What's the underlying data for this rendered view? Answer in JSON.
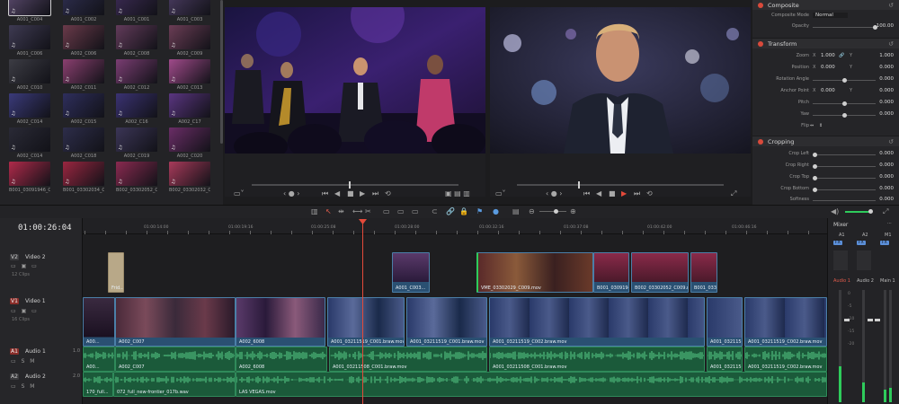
{
  "media_pool": {
    "clips": [
      {
        "label": "A001_C004",
        "thumb": "#5b4a6e",
        "sel": true
      },
      {
        "label": "A001_C002",
        "thumb": "#2e2e4f"
      },
      {
        "label": "A001_C001",
        "thumb": "#3c2b55"
      },
      {
        "label": "A001_C003",
        "thumb": "#4b3c62"
      },
      {
        "label": "A001_C006",
        "thumb": "#3e3a52"
      },
      {
        "label": "A002_C006",
        "thumb": "#6a3a4a"
      },
      {
        "label": "A002_C008",
        "thumb": "#623b5a"
      },
      {
        "label": "A002_C009",
        "thumb": "#6b3d55"
      },
      {
        "label": "A002_C010",
        "thumb": "#3c3c44"
      },
      {
        "label": "A002_C011",
        "thumb": "#8a3f6f"
      },
      {
        "label": "A002_C012",
        "thumb": "#7a3d72"
      },
      {
        "label": "A002_C013",
        "thumb": "#a04a8a"
      },
      {
        "label": "A002_C014",
        "thumb": "#3a3a7a"
      },
      {
        "label": "A002_C015",
        "thumb": "#2e2e5c"
      },
      {
        "label": "A002_C16",
        "thumb": "#3a3272"
      },
      {
        "label": "A002_C17",
        "thumb": "#5a3580"
      },
      {
        "label": "A002_C014",
        "thumb": "#2a2a36"
      },
      {
        "label": "A002_C018",
        "thumb": "#2d2d4a"
      },
      {
        "label": "A002_C019",
        "thumb": "#3b3556"
      },
      {
        "label": "A002_C020",
        "thumb": "#6a2d66"
      },
      {
        "label": "B001_03091946_C01...",
        "thumb": "#b02a4a"
      },
      {
        "label": "B001_03302034_C0...",
        "thumb": "#9a2640"
      },
      {
        "label": "B002_03302052_C0...",
        "thumb": "#8a2a50"
      },
      {
        "label": "B002_03302032_C0...",
        "thumb": "#a83a5a"
      }
    ]
  },
  "inspector": {
    "composite": {
      "title": "Composite",
      "mode_label": "Composite Mode",
      "mode_value": "Normal",
      "opacity_label": "Opacity",
      "opacity_value": "100.00"
    },
    "transform": {
      "title": "Transform",
      "zoom_label": "Zoom",
      "x_label": "X",
      "y_label": "Y",
      "zoom_x": "1.000",
      "zoom_y": "1.000",
      "position_label": "Position",
      "pos_x": "0.000",
      "pos_y": "0.000",
      "rotation_label": "Rotation Angle",
      "rotation_value": "0.000",
      "anchor_label": "Anchor Point",
      "anchor_x": "0.000",
      "anchor_y": "0.000",
      "pitch_label": "Pitch",
      "pitch_value": "0.000",
      "yaw_label": "Yaw",
      "yaw_value": "0.000",
      "flip_label": "Flip"
    },
    "cropping": {
      "title": "Cropping",
      "left_label": "Crop Left",
      "left_value": "0.000",
      "right_label": "Crop Right",
      "right_value": "0.000",
      "top_label": "Crop Top",
      "top_value": "0.000",
      "bottom_label": "Crop Bottom",
      "bottom_value": "0.000",
      "softness_label": "Softness",
      "softness_value": "0.000"
    }
  },
  "timeline": {
    "timecode": "01:00:26:04",
    "ruler": [
      "01:00:14:00",
      "01:00:19:16",
      "01:00:25:08",
      "01:00:28:00",
      "01:00:32:16",
      "01:00:37:08",
      "01:00:42:00",
      "01:00:46:16"
    ],
    "tracks": {
      "v2": {
        "id": "V2",
        "name": "Video 2",
        "sub": "12 Clips"
      },
      "v1": {
        "id": "V1",
        "name": "Video 1",
        "sub": "16 Clips"
      },
      "a1": {
        "id": "A1",
        "name": "Audio 1",
        "level": "1.0"
      },
      "a2": {
        "id": "A2",
        "name": "Audio 2",
        "level": "2.0"
      }
    },
    "v2_clips": [
      {
        "label": "Frid..."
      },
      {
        "label": "A001_C003..."
      },
      {
        "label": "VME_03302029_C009.mov"
      },
      {
        "label": "B001_03091946_..."
      },
      {
        "label": "B002_03302052_C009.mov"
      },
      {
        "label": "B001_0330..."
      }
    ],
    "v1_clips": [
      {
        "label": "A00..."
      },
      {
        "label": "A002_C007"
      },
      {
        "label": "A002_6008"
      },
      {
        "label": "A001_03211519_C001.braw.mov"
      },
      {
        "label": "A001_03211519_C001.braw.mov"
      },
      {
        "label": "A001_03211519_C002.braw.mov"
      },
      {
        "label": "A001_03211519_C..."
      },
      {
        "label": "A001_03211519_C002.braw.mov"
      }
    ],
    "a1_clips": [
      {
        "label": "A00..."
      },
      {
        "label": "A002_C007"
      },
      {
        "label": "A002_6008"
      },
      {
        "label": "A001_03211508_C001.braw.mov"
      },
      {
        "label": "A001_03211508_C001.braw.mov"
      },
      {
        "label": "A001_03211519_C002.braw.mov"
      },
      {
        "label": "A001_03211519_C002.braw.mov"
      }
    ],
    "a2_clips": [
      {
        "label": "170_full..."
      },
      {
        "label": "072_full_new-frontier_017b.wav"
      },
      {
        "label": "LAS VEGAS.mov"
      }
    ]
  },
  "mixer": {
    "title": "Mixer",
    "ch1": "A1",
    "ch2": "A2",
    "ch3": "M1",
    "btn": "FX",
    "names": [
      "Audio 1",
      "Audio 2",
      "Main 1"
    ],
    "scale": [
      "0",
      "-5",
      "-10",
      "-15",
      "-20"
    ]
  }
}
